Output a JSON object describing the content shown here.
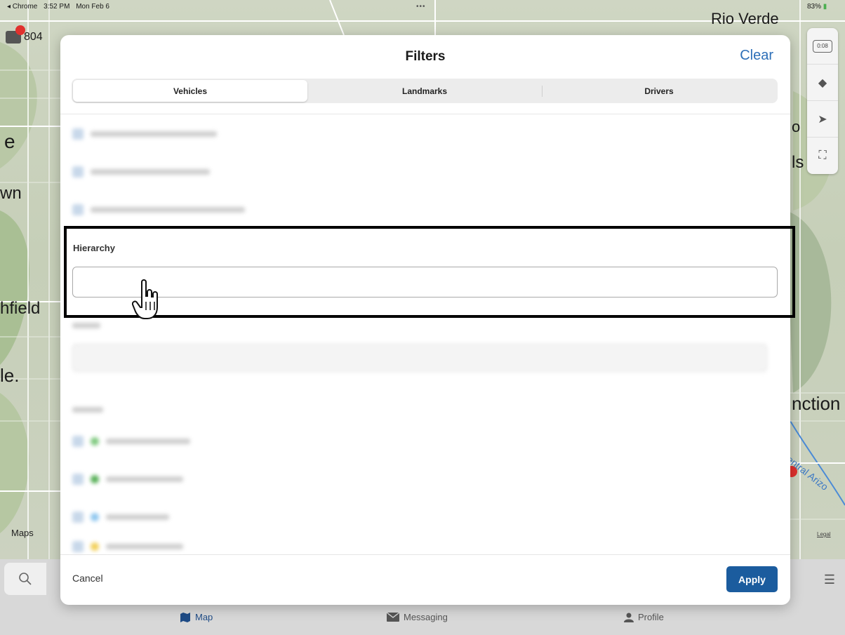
{
  "status_bar": {
    "back_app": "◂ Chrome",
    "time": "3:52 PM",
    "date": "Mon Feb 6",
    "battery": "83%"
  },
  "map": {
    "labels": {
      "rio_verde": "Rio Verde",
      "ho": "o",
      "ls": "ls",
      "e": "e",
      "wn": "wn",
      "chfield": "hfield",
      "le": "le.",
      "nction": "nction",
      "central_arizona": "Central Arizo"
    },
    "maps_logo": "Maps",
    "legal": "Legal",
    "vehicle_chip_text": "804",
    "clock_badge": "0:08"
  },
  "modal": {
    "title": "Filters",
    "clear_label": "Clear",
    "tabs": [
      {
        "label": "Vehicles",
        "active": true
      },
      {
        "label": "Landmarks",
        "active": false
      },
      {
        "label": "Drivers",
        "active": false
      }
    ],
    "hierarchy": {
      "label": "Hierarchy",
      "value": "",
      "placeholder": ""
    },
    "cancel_label": "Cancel",
    "apply_label": "Apply"
  },
  "tab_bar": {
    "items": [
      {
        "label": "Map",
        "icon": "map-icon",
        "active": true
      },
      {
        "label": "Messaging",
        "icon": "envelope-icon",
        "active": false
      },
      {
        "label": "Profile",
        "icon": "person-icon",
        "active": false
      }
    ]
  },
  "colors": {
    "accent": "#2d6fb8",
    "apply_bg": "#1b5c9e",
    "active_tab": "#1e4b86"
  }
}
